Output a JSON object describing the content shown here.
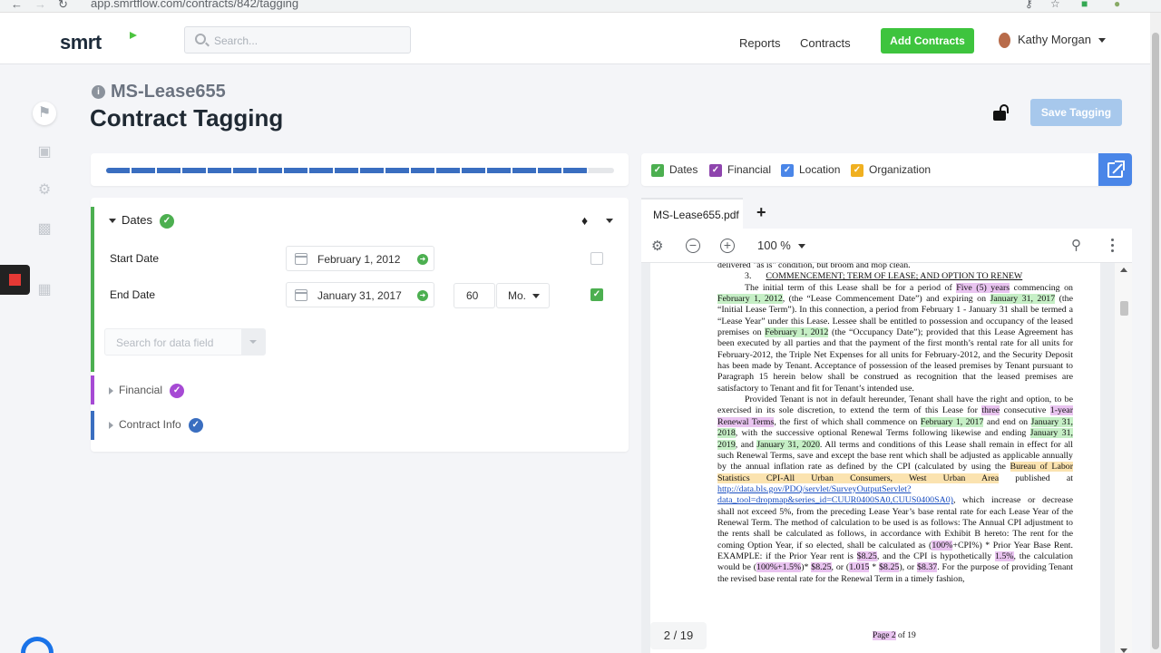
{
  "browser": {
    "url": "app.smrtflow.com/contracts/842/tagging"
  },
  "topbar": {
    "logo": "smrt",
    "search_placeholder": "Search...",
    "nav": [
      "Reports",
      "Contracts"
    ],
    "add_button": "Add Contracts",
    "user_name": "Kathy Morgan"
  },
  "sidebar_icons": [
    "tag-icon",
    "money-icon",
    "gear-icon",
    "chart-icon",
    "calculator-icon"
  ],
  "header": {
    "doc_id": "MS-Lease655",
    "title": "Contract Tagging",
    "save_button": "Save Tagging"
  },
  "progress": {
    "fraction": 0.95
  },
  "form": {
    "dates_label": "Dates",
    "start_label": "Start Date",
    "start_value": "February 1, 2012",
    "start_checked": false,
    "end_label": "End Date",
    "end_value": "January 31, 2017",
    "end_checked": true,
    "duration_value": "60",
    "duration_unit": "Mo.",
    "field_search_placeholder": "Search for data field",
    "sections": [
      "Financial",
      "Contract Info"
    ]
  },
  "legend": [
    "Dates",
    "Financial",
    "Location",
    "Organization"
  ],
  "colors": {
    "dates": "#4caf50",
    "financial": "#8e44ad",
    "location": "#4a86e8",
    "organization": "#f0b020",
    "accent_green": "#3ec43e",
    "accent_blue": "#4a86e8"
  },
  "viewer": {
    "tab": "MS-Lease655.pdf",
    "zoom": "100 %",
    "page_indicator": "2 / 19",
    "page_footer_a": "Page 2",
    "page_footer_b": " of 19"
  },
  "document": {
    "top_line": "delivered \"as is\" condition, but broom and mop clean.",
    "heading_num": "3.",
    "heading": "COMMENCEMENT; TERM OF LEASE; AND OPTION TO RENEW",
    "p1": [
      {
        "t": "The initial term of this Lease shall be for a period of "
      },
      {
        "t": "Five (5) years",
        "h": "hp"
      },
      {
        "t": " commencing on "
      },
      {
        "t": "February 1, 2012",
        "h": "hg"
      },
      {
        "t": ", (the “Lease Commencement Date”) and expiring on "
      },
      {
        "t": "January 31, 2017",
        "h": "hg"
      },
      {
        "t": " (the “Initial Lease Term”).  In this connection, a period from February 1 - January 31 shall be termed a “Lease Year” under this Lease.   Lessee shall be entitled to possession and occupancy of the leased premises on "
      },
      {
        "t": "February 1, 2012",
        "h": "hg"
      },
      {
        "t": " (the “Occupancy Date”); provided that this Lease Agreement has been executed by all parties and that the payment of the first month’s rental rate for all units for February-2012, the Triple Net Expenses for all units for February-2012, and the Security Deposit has been made by Tenant.  Acceptance of possession of the leased premises by Tenant pursuant to Paragraph 15 herein below shall be construed as recognition that the leased premises are satisfactory to Tenant and fit for Tenant’s intended use."
      }
    ],
    "p2": [
      {
        "t": "Provided Tenant is not in default hereunder, Tenant shall have the right and option, to be exercised in its sole discretion, to extend the term of this Lease for "
      },
      {
        "t": "three",
        "h": "hp"
      },
      {
        "t": " consecutive "
      },
      {
        "t": "1-year Renewal Terms",
        "h": "hp"
      },
      {
        "t": ", the first of which shall commence on "
      },
      {
        "t": "February 1, 2017",
        "h": "hg"
      },
      {
        "t": " and end on "
      },
      {
        "t": "January 31, 2018",
        "h": "hg"
      },
      {
        "t": ", with the successive optional Renewal Terms following likewise and ending "
      },
      {
        "t": "January 31, 2019",
        "h": "hg"
      },
      {
        "t": ", and "
      },
      {
        "t": "January 31, 2020",
        "h": "hg"
      },
      {
        "t": ".  All terms and conditions of this Lease shall remain in effect for all such Renewal Terms, save and except the base rent which shall be adjusted as applicable annually by the annual inflation rate as defined by the CPI (calculated by using the "
      },
      {
        "t": "Bureau of Labor Statistics CPI-All Urban Consumers, West Urban Area",
        "h": "ho"
      },
      {
        "t": " published at "
      },
      {
        "t": "http://data.bls.gov/PDQ/servlet/SurveyOutputServlet?data_tool=dropmap&series_id=CUUR0400SA0,CUUS0400SA0)",
        "h": "lk"
      },
      {
        "t": ", which increase or decrease shall not exceed 5%, from the preceding Lease Year’s base rental rate for each Lease Year of the Renewal Term.  The method of calculation to be used is as follows: The Annual CPI adjustment to the rents shall be calculated as follows, in accordance with Exhibit B hereto: The rent for the coming Option Year, if so elected, shall be calculated as ("
      },
      {
        "t": "100%",
        "h": "hp"
      },
      {
        "t": "+CPI%) * Prior Year Base Rent. EXAMPLE: if the Prior Year rent is "
      },
      {
        "t": "$8.25",
        "h": "hp"
      },
      {
        "t": ", and the CPI is hypothetically "
      },
      {
        "t": "1.5%",
        "h": "hp"
      },
      {
        "t": ", the calculation would be ("
      },
      {
        "t": "100%+1.5%",
        "h": "hp"
      },
      {
        "t": ")* "
      },
      {
        "t": "$8.25",
        "h": "hp"
      },
      {
        "t": ", or ("
      },
      {
        "t": "1.015",
        "h": "hp"
      },
      {
        "t": " * "
      },
      {
        "t": "$8.25",
        "h": "hp"
      },
      {
        "t": "), or "
      },
      {
        "t": "$8.37",
        "h": "hp"
      },
      {
        "t": ".  For the purpose of providing Tenant the revised base rental rate for the Renewal Term in a timely fashion,"
      }
    ]
  }
}
